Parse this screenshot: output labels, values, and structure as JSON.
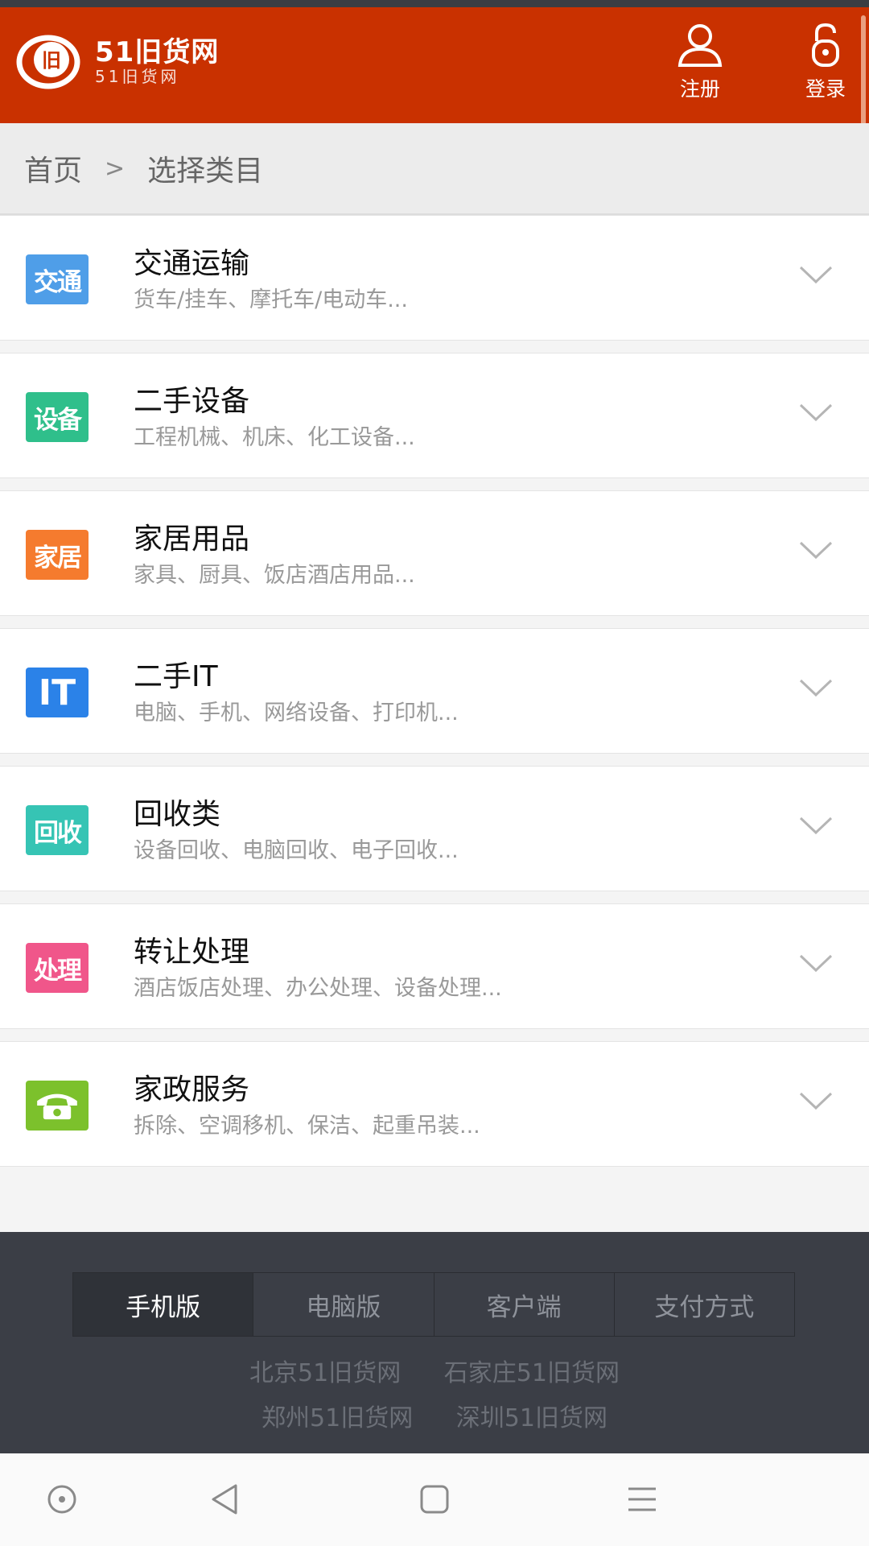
{
  "header": {
    "logo_title": "51旧货网",
    "logo_sub": "51旧货网",
    "logo_mark_text": "旧",
    "register_label": "注册",
    "login_label": "登录",
    "brand_color": "#c93100"
  },
  "breadcrumb": {
    "home": "首页",
    "separator": ">",
    "current": "选择类目"
  },
  "categories": [
    {
      "icon_text": "交通",
      "icon_color": "#4f9ee8",
      "title": "交通运输",
      "desc": "货车/挂车、摩托车/电动车..."
    },
    {
      "icon_text": "设备",
      "icon_color": "#2fbf8b",
      "title": "二手设备",
      "desc": "工程机械、机床、化工设备..."
    },
    {
      "icon_text": "家居",
      "icon_color": "#f57b2e",
      "title": "家居用品",
      "desc": "家具、厨具、饭店酒店用品..."
    },
    {
      "icon_text": "IT",
      "icon_color": "#2b82e8",
      "title": "二手IT",
      "desc": "电脑、手机、网络设备、打印机..."
    },
    {
      "icon_text": "回收",
      "icon_color": "#36c4b4",
      "title": "回收类",
      "desc": "设备回收、电脑回收、电子回收..."
    },
    {
      "icon_text": "处理",
      "icon_color": "#f0568a",
      "title": "转让处理",
      "desc": "酒店饭店处理、办公处理、设备处理..."
    },
    {
      "icon_text": "phone-icon",
      "icon_color": "#7cc12c",
      "title": "家政服务",
      "desc": "拆除、空调移机、保洁、起重吊装..."
    }
  ],
  "footer": {
    "tabs": [
      "手机版",
      "电脑版",
      "客户端",
      "支付方式"
    ],
    "active_tab": "手机版",
    "city_links": [
      [
        "北京51旧货网",
        "石家庄51旧货网"
      ],
      [
        "郑州51旧货网",
        "深圳51旧货网"
      ]
    ]
  },
  "navbar": {
    "icons": [
      "circle-dot-icon",
      "back-triangle-icon",
      "home-square-icon",
      "menu-lines-icon"
    ]
  }
}
